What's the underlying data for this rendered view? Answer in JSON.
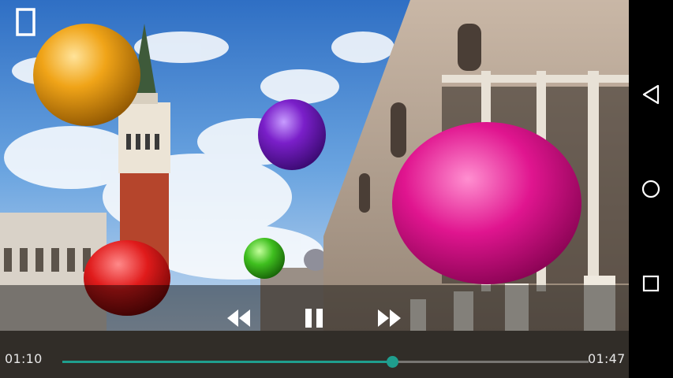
{
  "player": {
    "current_time": "01:10",
    "total_time": "01:47",
    "progress": 0.627,
    "accent_color": "#1f9e8e",
    "fullscreen_icon": "fullscreen-toggle-icon",
    "controls": {
      "rewind_icon": "rewind-icon",
      "pause_icon": "pause-icon",
      "fast_forward_icon": "fast-forward-icon"
    }
  },
  "navbar": {
    "back_icon": "back-triangle-icon",
    "home_icon": "home-circle-icon",
    "recents_icon": "recents-square-icon"
  },
  "scene": {
    "balloon_colors": [
      "#f0a418",
      "#7a1fc9",
      "#e0158f",
      "#3fbf1f",
      "#e01b1b"
    ]
  }
}
